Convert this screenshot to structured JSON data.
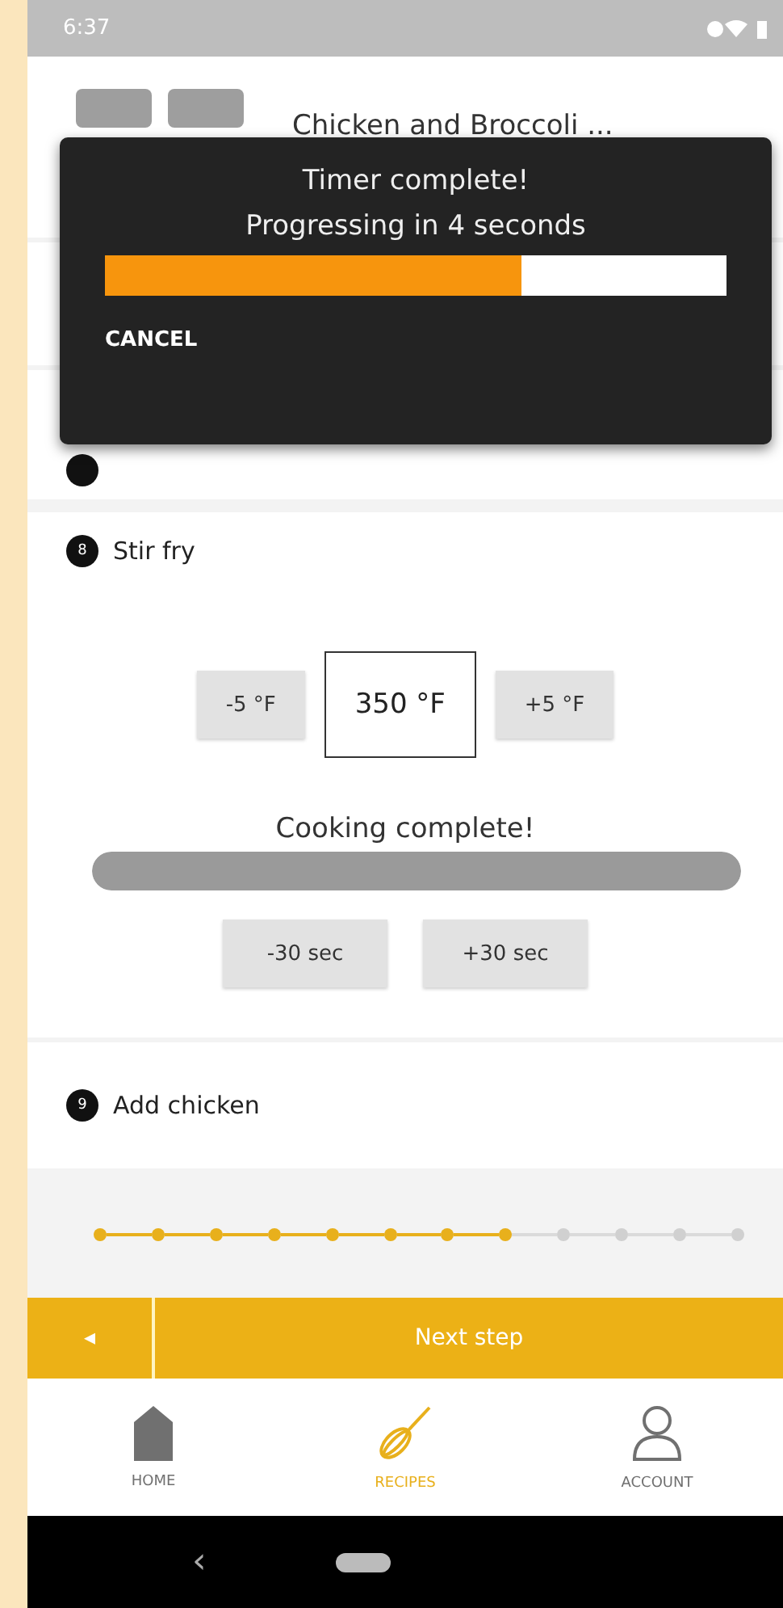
{
  "status_bar": {
    "time": "6:37"
  },
  "header": {
    "title": "Chicken and Broccoli ..."
  },
  "timer_dialog": {
    "title": "Timer complete!",
    "message": "Progressing in 4 seconds",
    "level": 0.67,
    "action": "CANCEL"
  },
  "steps": [
    {
      "number": "8",
      "title": "Stir fry",
      "kind": "timer",
      "temperature": {
        "decrease": "-5 °F",
        "value": "350 °F",
        "increase": "+5 °F"
      },
      "status": "Cooking complete!",
      "level": 1,
      "time_buttons": [
        "-30 sec",
        "+30 sec"
      ]
    },
    {
      "number": "9",
      "title": "Add chicken",
      "kind": "plain"
    }
  ],
  "progress_dots": [
    {
      "done": true
    },
    {
      "done": true
    },
    {
      "done": true
    },
    {
      "done": true
    },
    {
      "done": true
    },
    {
      "done": true
    },
    {
      "done": true
    },
    {
      "done": true
    },
    {
      "done": false
    },
    {
      "done": false
    },
    {
      "done": false
    },
    {
      "done": false
    }
  ],
  "back_icon": "◂",
  "next_button": "Next step",
  "nav": [
    {
      "label": "HOME",
      "kind": "home",
      "selected": false
    },
    {
      "label": "RECIPES",
      "kind": "recipes",
      "selected": true
    },
    {
      "label": "ACCOUNT",
      "kind": "account",
      "selected": false
    }
  ],
  "system_back": "‹"
}
